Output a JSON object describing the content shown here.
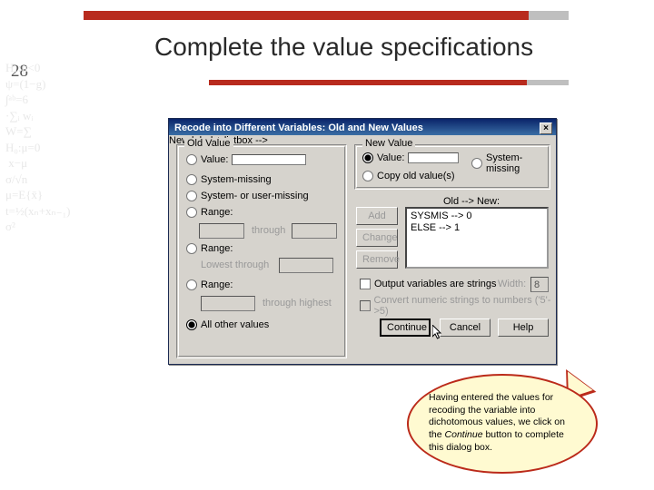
{
  "slide": {
    "page_number": "28",
    "title": "Complete the value specifications"
  },
  "bg_math": "H₁:μ<0\nψ=(1−g)\n∫ᵃᵇ=6\n·∑ᵢ wᵢ\nW=∑\nH₀:μ=0\n x−μ\nσ/√n\nμ=E{x̄}\nt=½(xₙ+xₙ₋₁)\nσ²",
  "dialog": {
    "title": "Recode into Different Variables: Old and New Values",
    "close_glyph": "×",
    "old_group": "Old Value",
    "new_group": "New Value",
    "old": {
      "value": "Value:",
      "sysmis": "System-missing",
      "sysuser": "System- or user-missing",
      "range1": "Range:",
      "through": "through",
      "range2": "Range:",
      "lowest": "Lowest through",
      "range3": "Range:",
      "highest": "through highest",
      "allother": "All other values"
    },
    "new": {
      "value": "Value:",
      "sysmis": "System-missing",
      "copyold": "Copy old value(s)"
    },
    "listbox_label": "Old --> New:",
    "list_items": [
      "SYSMIS --> 0",
      "ELSE --> 1"
    ],
    "buttons": {
      "add": "Add",
      "change": "Change",
      "remove": "Remove",
      "continue": "Continue",
      "cancel": "Cancel",
      "help": "Help"
    },
    "output_strings": "Output variables are strings",
    "width_label": "Width:",
    "width_value": "8",
    "convert_numeric": "Convert numeric strings to numbers ('5'->5)"
  },
  "callout": {
    "text_a": "Having entered the values for recoding the variable into dichotomous values, we click on the ",
    "text_b": "Continue",
    "text_c": " button to complete this dialog box."
  }
}
